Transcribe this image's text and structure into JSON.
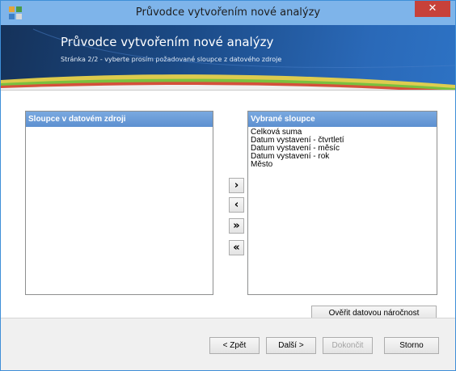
{
  "window": {
    "title": "Průvodce vytvořením nové analýzy",
    "close_glyph": "✕"
  },
  "banner": {
    "title": "Průvodce vytvořením nové analýzy",
    "subtitle": "Stránka 2/2 - vyberte prosím požadované sloupce z datového zdroje"
  },
  "source_panel": {
    "header": "Sloupce v datovém zdroji",
    "items": []
  },
  "selected_panel": {
    "header": "Vybrané sloupce",
    "items": [
      "Celková suma",
      "Datum vystavení - čtvrtletí",
      "Datum vystavení - měsíc",
      "Datum vystavení - rok",
      "Město"
    ]
  },
  "move_buttons": {
    "add": "›",
    "remove": "‹",
    "add_all": "»",
    "remove_all": "«"
  },
  "actions": {
    "verify": "Ověřit datovou náročnost"
  },
  "footer": {
    "back": "< Zpět",
    "next": "Další >",
    "finish": "Dokončit",
    "cancel": "Storno"
  },
  "icons": {
    "app": "app-grid-icon",
    "close": "close-icon"
  },
  "colors": {
    "titlebar": "#7eb4ea",
    "close": "#c7413a",
    "banner": "#1b4a86",
    "panel_header": "#6a9bd8"
  }
}
